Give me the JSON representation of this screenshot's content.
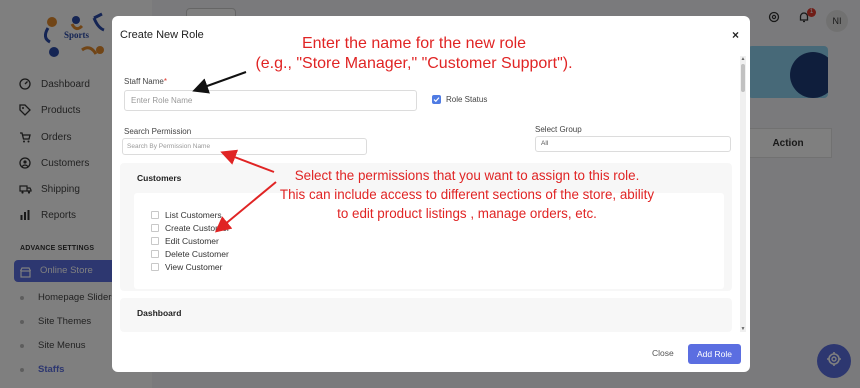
{
  "sidebar": {
    "logo_text": "Sports",
    "items": [
      {
        "label": "Dashboard",
        "icon": "speedometer-icon"
      },
      {
        "label": "Products",
        "icon": "tag-icon"
      },
      {
        "label": "Orders",
        "icon": "cart-icon"
      },
      {
        "label": "Customers",
        "icon": "user-circle-icon"
      },
      {
        "label": "Shipping",
        "icon": "truck-icon"
      },
      {
        "label": "Reports",
        "icon": "chart-icon"
      }
    ],
    "section_title": "ADVANCE SETTINGS",
    "active_item": {
      "label": "Online Store",
      "icon": "store-icon"
    },
    "sub_items": [
      "Homepage Sliders",
      "Site Themes",
      "Site Menus",
      "Staffs"
    ]
  },
  "header": {
    "notification_count": "1",
    "avatar_initials": "NI"
  },
  "table": {
    "action_header": "Action"
  },
  "modal": {
    "title": "Create New Role",
    "close_glyph": "×",
    "staff_name_label": "Staff Name",
    "required_mark": "*",
    "staff_name_placeholder": "Enter Role Name",
    "role_status_label": "Role Status",
    "search_permission_label": "Search Permission",
    "search_permission_placeholder": "Search By Permission Name",
    "select_group_label": "Select Group",
    "select_group_value": "All",
    "sections": [
      {
        "title": "Customers",
        "permissions": [
          "List Customers",
          "Create Customer",
          "Edit Customer",
          "Delete Customer",
          "View Customer"
        ]
      },
      {
        "title": "Dashboard",
        "permissions": []
      }
    ],
    "close_label": "Close",
    "add_role_label": "Add Role"
  },
  "annotations": {
    "line1": "Enter the name for the new role",
    "line2": "(e.g., \"Store Manager,\" \"Customer Support\").",
    "para_line1": "Select the permissions that you want to assign to this role.",
    "para_line2": "This can include access to different sections of the store, ability",
    "para_line3": "to edit product listings , manage orders, etc."
  },
  "colors": {
    "accent": "#5b6ee1",
    "annotation": "#e02424",
    "checkbox": "#4f7be3"
  }
}
